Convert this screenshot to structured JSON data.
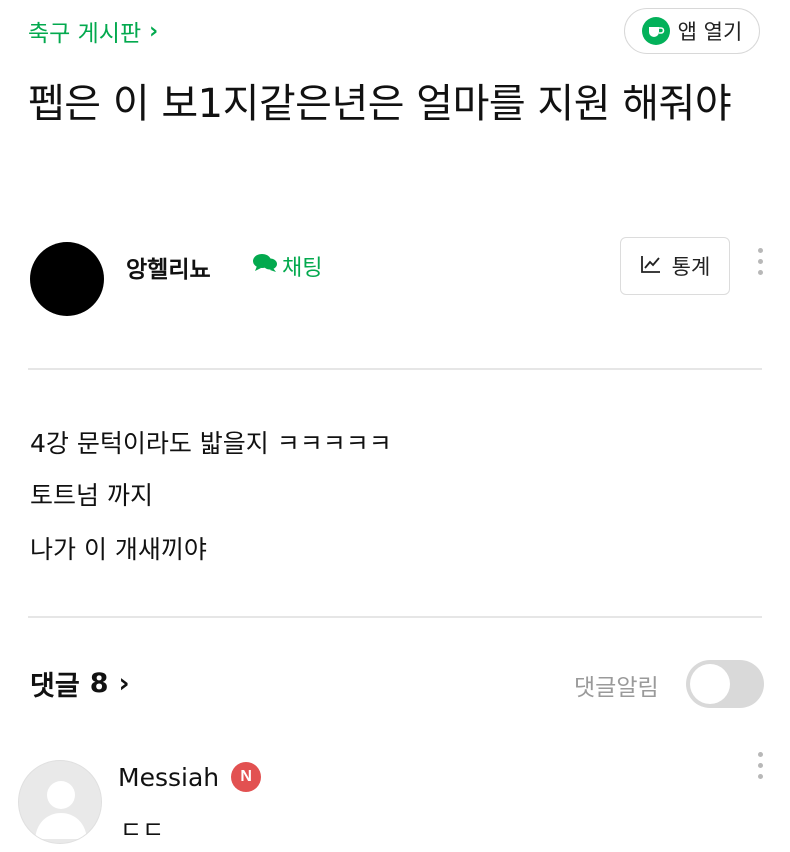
{
  "header": {
    "board_name": "축구 게시판",
    "board_chevron": "›",
    "app_open_label": "앱 열기",
    "accent_color": "#03a94e"
  },
  "post": {
    "title": "펩은 이 보1지같은년은 얼마를 지원 해줘야",
    "author": "앙헬리뇨",
    "chat_label": "채팅",
    "stats_label": "통계",
    "body": [
      "4강 문턱이라도 밟을지 ㅋㅋㅋㅋㅋ",
      "토트넘 까지",
      "나가 이 개새끼야"
    ]
  },
  "comments": {
    "title": "댓글",
    "count": "8",
    "chevron": "›",
    "notify_label": "댓글알림",
    "notify_enabled": false,
    "items": [
      {
        "author": "Messiah",
        "badge": "N",
        "text": "ㄷㄷ"
      }
    ]
  },
  "icons": {
    "app": "coffee-cup-icon",
    "chat": "chat-bubble-icon",
    "stats": "line-chart-icon",
    "more": "more-vertical-icon",
    "avatar_placeholder": "user-silhouette-icon"
  }
}
